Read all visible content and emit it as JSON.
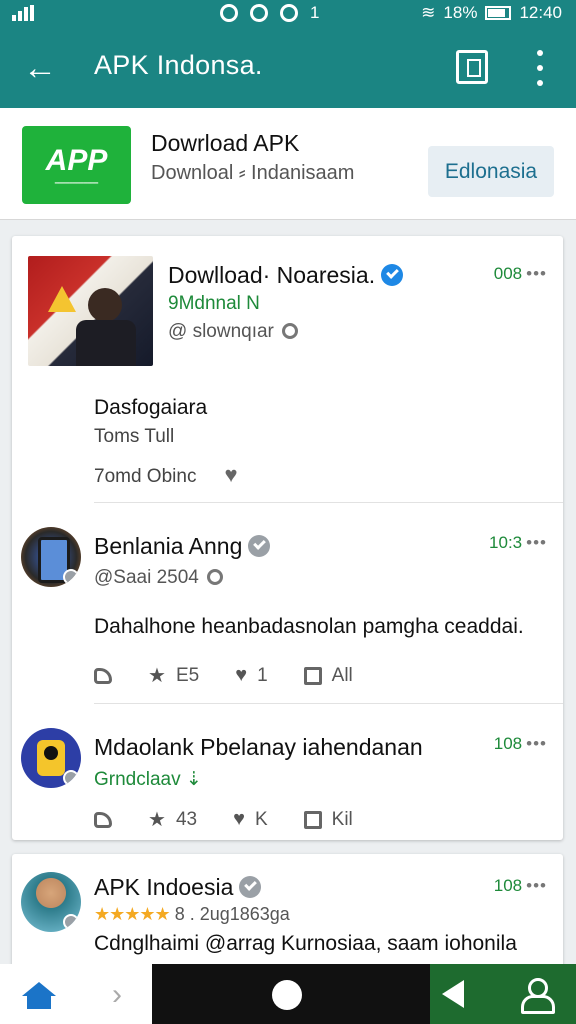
{
  "status_bar": {
    "battery": "18%",
    "time": "12:40",
    "center_text": "1"
  },
  "app_bar": {
    "title": "APK Indonsa."
  },
  "app_header": {
    "logo_text": "APP",
    "name": "Dowrload APK",
    "subtitle": "Downloal ⸗ Indanisaam",
    "language_button": "Edlonasia"
  },
  "posts": [
    {
      "author": "Dowlload· Noaresia.",
      "verified": "blue",
      "time": "008",
      "handle_line1": "9Mdnnal N",
      "handle_line2": "@ slownqıar",
      "body": "Dasfogaiara",
      "sub_line": "Toms Tull",
      "footer_text": "7omd Obinc"
    },
    {
      "author": "Benlania Anng",
      "verified": "grey",
      "time": "10:3",
      "handle": "@Saai 2504",
      "body": "Dahalhone heanbadasnolan pamgha ceaddai.",
      "actions": {
        "star": "E5",
        "heart": "1",
        "share": "All"
      }
    },
    {
      "author": "Mdaolank Pbelanay iahendanan",
      "time": "108",
      "handle": "Grndclaav",
      "actions": {
        "star": "43",
        "heart": "K",
        "share": "Kil"
      }
    },
    {
      "author": "APK Indoesia",
      "verified": "grey",
      "time": "108",
      "rating_stars": "★★★★★",
      "rating_text": "8 . 2ug1863ga",
      "body": "Cdnglhaimi @arrag Kurnosiaa, saam iohonila"
    }
  ],
  "colors": {
    "primary": "#1b8583",
    "accent_green": "#1e8a3a",
    "verified_blue": "#1e88e5",
    "logo_green": "#1fb23b"
  },
  "icons": [
    "back-arrow-icon",
    "bookmark-icon",
    "more-vert-icon",
    "verified-icon",
    "heart-icon",
    "star-icon",
    "reply-icon",
    "share-icon",
    "home-icon",
    "chevron-right-icon",
    "profile-icon"
  ]
}
